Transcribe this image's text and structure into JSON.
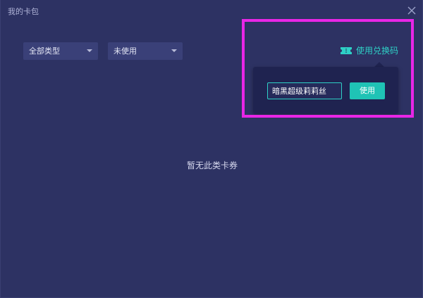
{
  "window": {
    "title": "我的卡包"
  },
  "filters": {
    "type_select": {
      "selected": "全部类型"
    },
    "status_select": {
      "selected": "未使用"
    }
  },
  "redeem": {
    "link_label": "使用兑换码",
    "icon": "ticket-icon",
    "input_value": "暗黑超级莉莉丝",
    "button_label": "使用"
  },
  "empty_state": {
    "message": "暂无此类卡券"
  },
  "colors": {
    "background": "#2d3263",
    "accent": "#2ed0c6",
    "button": "#1fc3b5",
    "popover": "#1f2350",
    "highlight": "#e826e6"
  }
}
